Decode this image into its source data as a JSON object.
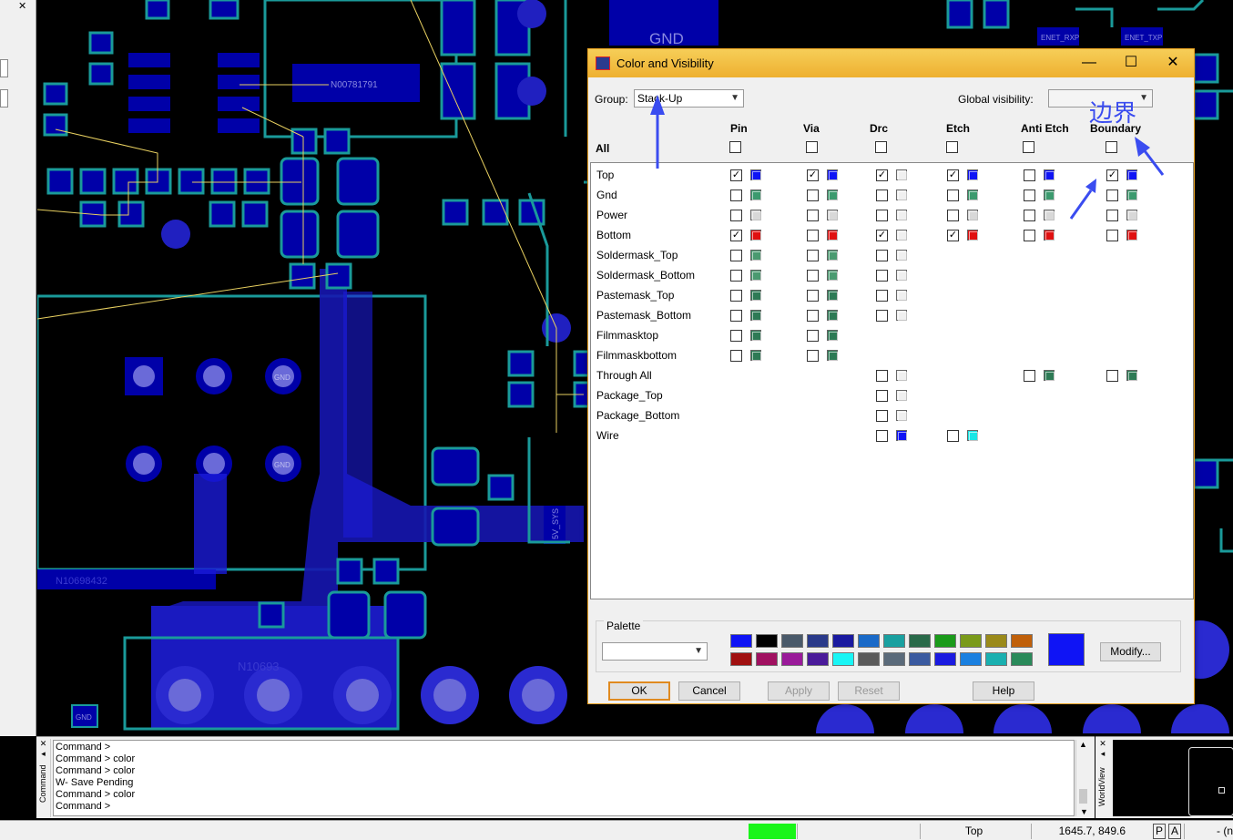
{
  "canvas": {
    "labels": {
      "gnd_block": "GND",
      "net_label_1": "N00781791",
      "net_rxp": "ENET_RXP",
      "net_txp": "ENET_TXP",
      "gnd_pad_1": "GND",
      "gnd_pad_2": "GND",
      "gnd_small": "GND",
      "net_label_2": "N10698432",
      "net_label_3": "N10693",
      "vsys": "5V_SYS"
    }
  },
  "dialog": {
    "title": "Color and Visibility",
    "group_label": "Group:",
    "group_value": "Stack-Up",
    "global_visibility_label": "Global visibility:",
    "global_visibility_value": "",
    "all_label": "All",
    "columns": [
      "Pin",
      "Via",
      "Drc",
      "Etch",
      "Anti Etch",
      "Boundary"
    ],
    "rows": [
      {
        "name": "Top",
        "cells": [
          {
            "checked": true,
            "color": "#0f14f5"
          },
          {
            "checked": true,
            "color": "#0f14f5"
          },
          {
            "checked": true,
            "color": "#f0f0f0"
          },
          {
            "checked": true,
            "color": "#0f14f5"
          },
          {
            "checked": false,
            "color": "#0f14f5"
          },
          {
            "checked": true,
            "color": "#0f14f5"
          }
        ]
      },
      {
        "name": "Gnd",
        "cells": [
          {
            "checked": false,
            "color": "#3c9a6e"
          },
          {
            "checked": false,
            "color": "#3c9a6e"
          },
          {
            "checked": false,
            "color": "#f0f0f0"
          },
          {
            "checked": false,
            "color": "#3c9a6e"
          },
          {
            "checked": false,
            "color": "#3c9a6e"
          },
          {
            "checked": false,
            "color": "#3c9a6e"
          }
        ]
      },
      {
        "name": "Power",
        "cells": [
          {
            "checked": false,
            "color": "#d8d8d8"
          },
          {
            "checked": false,
            "color": "#d8d8d8"
          },
          {
            "checked": false,
            "color": "#f0f0f0"
          },
          {
            "checked": false,
            "color": "#d8d8d8"
          },
          {
            "checked": false,
            "color": "#d8d8d8"
          },
          {
            "checked": false,
            "color": "#d8d8d8"
          }
        ]
      },
      {
        "name": "Bottom",
        "cells": [
          {
            "checked": true,
            "color": "#e01010"
          },
          {
            "checked": false,
            "color": "#e01010"
          },
          {
            "checked": true,
            "color": "#f0f0f0"
          },
          {
            "checked": true,
            "color": "#e01010"
          },
          {
            "checked": false,
            "color": "#e01010"
          },
          {
            "checked": false,
            "color": "#e01010"
          }
        ]
      },
      {
        "name": "Soldermask_Top",
        "cells": [
          {
            "checked": false,
            "color": "#4a9a70"
          },
          {
            "checked": false,
            "color": "#4a9a70"
          },
          {
            "checked": false,
            "color": "#f0f0f0"
          },
          null,
          null,
          null
        ]
      },
      {
        "name": "Soldermask_Bottom",
        "cells": [
          {
            "checked": false,
            "color": "#4a9a70"
          },
          {
            "checked": false,
            "color": "#4a9a70"
          },
          {
            "checked": false,
            "color": "#f0f0f0"
          },
          null,
          null,
          null
        ]
      },
      {
        "name": "Pastemask_Top",
        "cells": [
          {
            "checked": false,
            "color": "#2d7a55"
          },
          {
            "checked": false,
            "color": "#2d7a55"
          },
          {
            "checked": false,
            "color": "#f0f0f0"
          },
          null,
          null,
          null
        ]
      },
      {
        "name": "Pastemask_Bottom",
        "cells": [
          {
            "checked": false,
            "color": "#2d7a55"
          },
          {
            "checked": false,
            "color": "#2d7a55"
          },
          {
            "checked": false,
            "color": "#f0f0f0"
          },
          null,
          null,
          null
        ]
      },
      {
        "name": "Filmmasktop",
        "cells": [
          {
            "checked": false,
            "color": "#2d7a55"
          },
          {
            "checked": false,
            "color": "#2d7a55"
          },
          null,
          null,
          null,
          null
        ]
      },
      {
        "name": "Filmmaskbottom",
        "cells": [
          {
            "checked": false,
            "color": "#2d7a55"
          },
          {
            "checked": false,
            "color": "#2d7a55"
          },
          null,
          null,
          null,
          null
        ]
      },
      {
        "name": "Through All",
        "cells": [
          null,
          null,
          {
            "checked": false,
            "color": "#f0f0f0"
          },
          null,
          {
            "checked": false,
            "color": "#2d7a55"
          },
          {
            "checked": false,
            "color": "#2d7a55"
          }
        ]
      },
      {
        "name": "Package_Top",
        "cells": [
          null,
          null,
          {
            "checked": false,
            "color": "#f0f0f0"
          },
          null,
          null,
          null
        ]
      },
      {
        "name": "Package_Bottom",
        "cells": [
          null,
          null,
          {
            "checked": false,
            "color": "#f0f0f0"
          },
          null,
          null,
          null
        ]
      },
      {
        "name": "Wire",
        "cells": [
          null,
          null,
          {
            "checked": false,
            "color": "#0f14f5"
          },
          {
            "checked": false,
            "color": "#19e6e6"
          },
          null,
          null
        ]
      }
    ],
    "palette_label": "Palette",
    "palette_row1": [
      "#0f14f5",
      "#000000",
      "#4a5a6a",
      "#2a3a8a",
      "#1a1aa0",
      "#1a6ac8",
      "#1aa0a0",
      "#2a6a4a",
      "#1a9a1a",
      "#7a9a1a",
      "#9a8a1a",
      "#c0600a"
    ],
    "palette_row2": [
      "#a01010",
      "#a01060",
      "#9a1a9a",
      "#4a1a9a",
      "#19f5f5",
      "#5a5a5a",
      "#5a6a7a",
      "#3a5aa0",
      "#1a1ae0",
      "#1a80e0",
      "#1ab0b0",
      "#2a8a5a"
    ],
    "current_color": "#0f14f5",
    "buttons": {
      "modify": "Modify...",
      "ok": "OK",
      "cancel": "Cancel",
      "apply": "Apply",
      "reset": "Reset",
      "help": "Help"
    }
  },
  "annotation": {
    "text": "边界"
  },
  "command": {
    "lines": [
      "Command >",
      "Command > color",
      "Command > color",
      "W- Save Pending",
      "Command > color",
      "Command >"
    ],
    "panel_tab": "Command",
    "worldview_tab": "WorldView"
  },
  "status": {
    "layer": "Top",
    "coords": "1645.7, 849.6",
    "p_btn": "P",
    "a_btn": "A",
    "trail": "- (n"
  }
}
